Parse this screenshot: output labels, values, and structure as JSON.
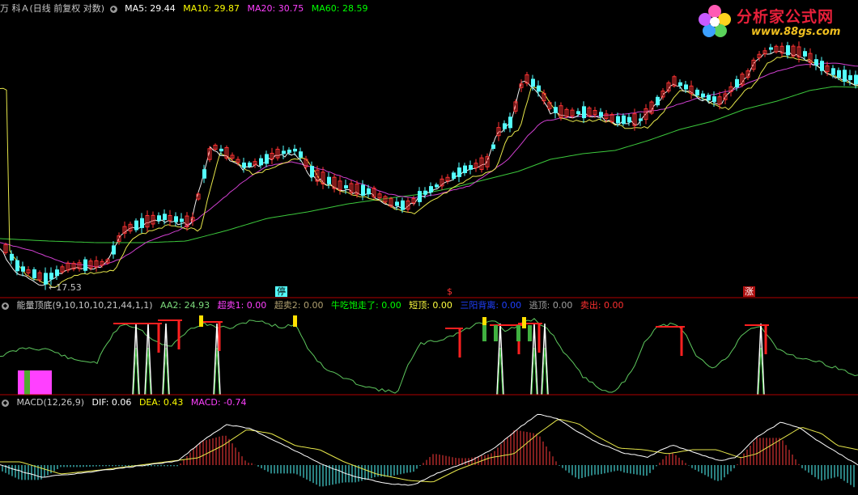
{
  "main_panel": {
    "title": "万 科Ａ(日线 前复权 对数)",
    "ma5": "MA5: 29.44",
    "ma10": "MA10: 29.87",
    "ma20": "MA20: 30.75",
    "ma60": "MA60: 28.59",
    "low_label": "←17.53",
    "marker_1": "停",
    "marker_2": "$",
    "marker_3": "涨",
    "colors": {
      "ma5": "#ffffff",
      "ma10": "#ffff00",
      "ma20": "#ff40ff",
      "ma60": "#00ff00",
      "up": "#ff3333",
      "down": "#54ffff"
    }
  },
  "watermark": {
    "title": "分析家公式网",
    "url": "www.88gs.com",
    "logo": "flower-logo"
  },
  "indicator_panel": {
    "title": "能量顶底(9,10,10,10,21,44,1,1)",
    "aa2": "AA2: 24.93",
    "chaomai1": "超卖1: 0.00",
    "chaomai2": "超卖2: 0.00",
    "niuchi": "牛吃饱走了: 0.00",
    "duanding": "短顶: 0.00",
    "sanyang": "三阳背离: 0.00",
    "taoding": "逃顶: 0.00",
    "maichu": "卖出: 0.00"
  },
  "macd_panel": {
    "title": "MACD(12,26,9)",
    "dif": "DIF: 0.06",
    "dea": "DEA: 0.43",
    "macd": "MACD: -0.74"
  }
}
